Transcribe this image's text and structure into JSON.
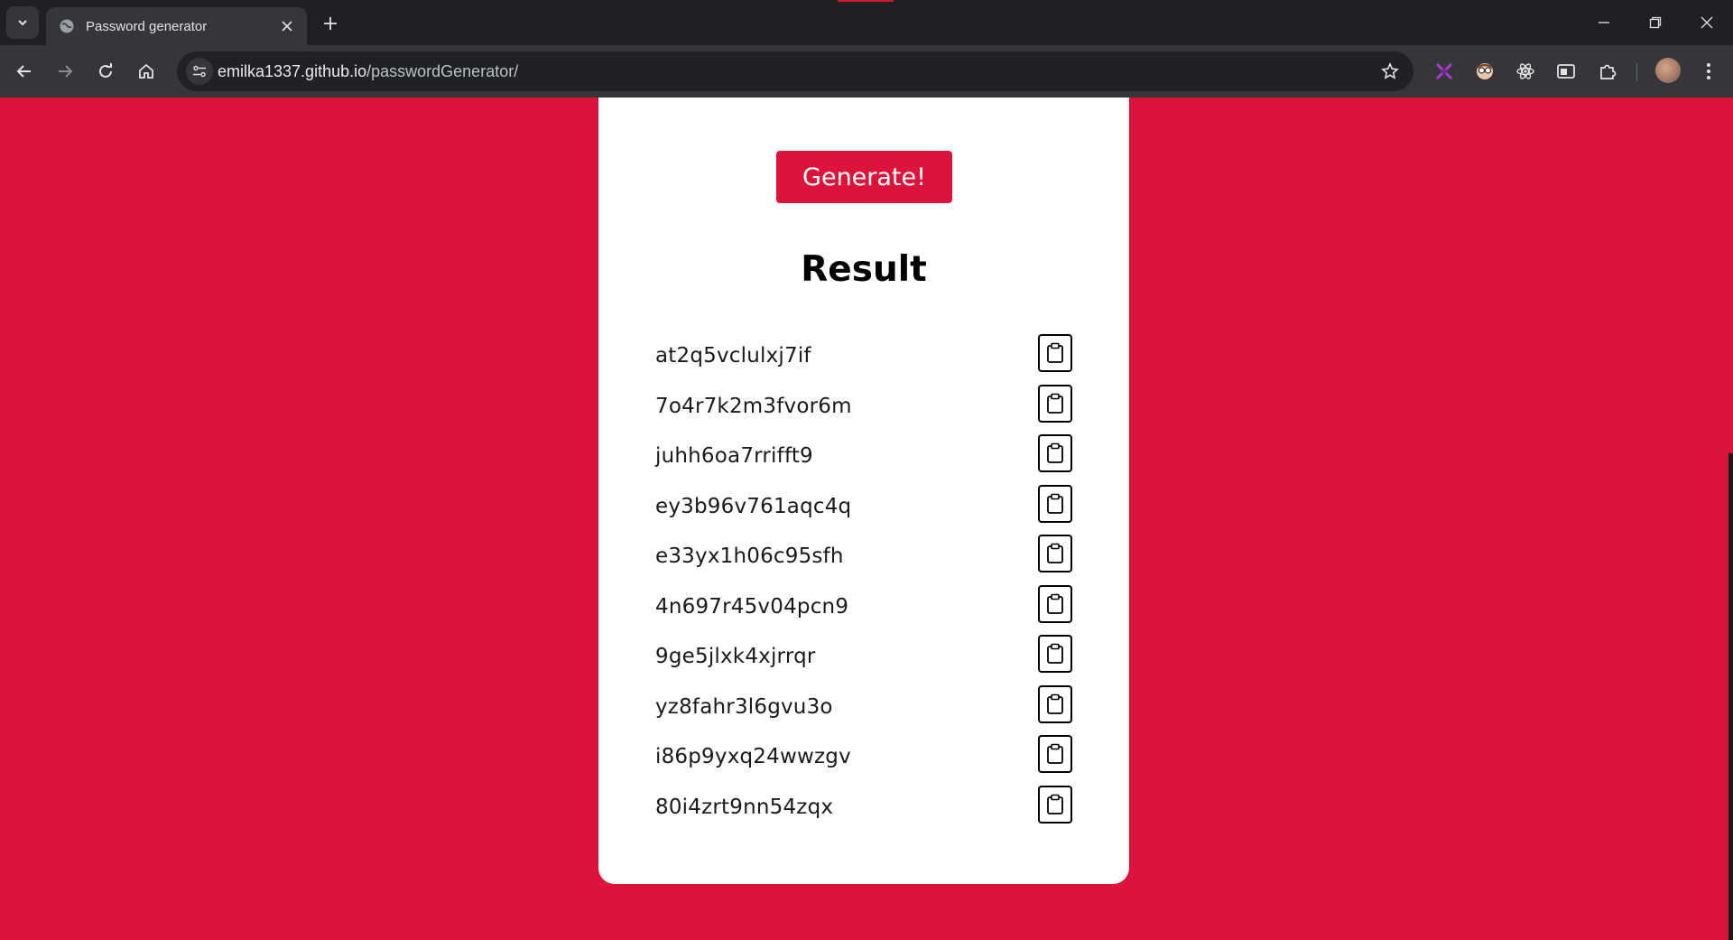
{
  "browser": {
    "tab_title": "Password generator",
    "url_host": "emilka1337.github.io",
    "url_path": "/passwordGenerator/"
  },
  "page": {
    "generate_label": "Generate!",
    "result_title": "Result",
    "passwords": [
      "at2q5vclulxj7if",
      "7o4r7k2m3fvor6m",
      "juhh6oa7rrifft9",
      "ey3b96v761aqc4q",
      "e33yx1h06c95sfh",
      "4n697r45v04pcn9",
      "9ge5jlxk4xjrrqr",
      "yz8fahr3l6gvu3o",
      "i86p9yxq24wwzgv",
      "80i4zrt9nn54zqx"
    ]
  },
  "colors": {
    "background": "#dc143c",
    "card": "#ffffff",
    "button": "#dc143c"
  },
  "icons": {
    "copy": "clipboard-icon"
  }
}
